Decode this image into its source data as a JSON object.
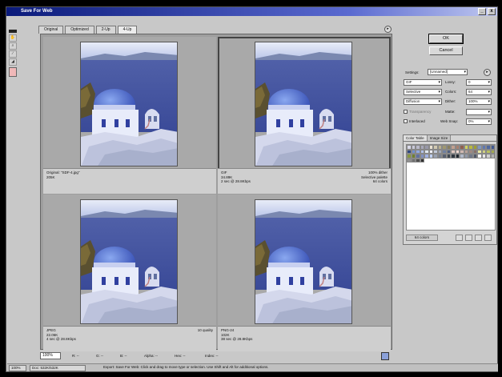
{
  "window": {
    "title": "Save For Web",
    "minimize_label": "_",
    "close_label": "x"
  },
  "tools": [
    "hand",
    "zoom",
    "eyedropper",
    "slice",
    "select"
  ],
  "tabs": [
    {
      "label": "Original",
      "active": false
    },
    {
      "label": "Optimized",
      "active": false
    },
    {
      "label": "2-Up",
      "active": false
    },
    {
      "label": "4-Up",
      "active": true
    }
  ],
  "panes": [
    {
      "left_lines": [
        "Original: \"SDF-4.jpg\"",
        "205K"
      ],
      "right_lines": [],
      "selected": false
    },
    {
      "left_lines": [
        "GIF",
        "34.89K",
        "2 sec @ 28.8Kbps"
      ],
      "right_lines": [
        "100% dither",
        "Selective palette",
        "64 colors"
      ],
      "selected": true
    },
    {
      "left_lines": [
        "JPEG",
        "22.06K",
        "4 sec @ 28.8Kbps"
      ],
      "right_lines": [
        "10 quality"
      ],
      "selected": false
    },
    {
      "left_lines": [
        "PNG-24",
        "102K",
        "38 sec @ 28.8Kbps"
      ],
      "right_lines": [],
      "selected": false
    }
  ],
  "side": {
    "ok_label": "OK",
    "cancel_label": "Cancel",
    "settings_label": "Settings:",
    "settings_value": "[Unnamed]",
    "format_value": "GIF",
    "reduction_value": "Selective",
    "dither_algo_value": "Diffusion",
    "lossy_label": "Lossy:",
    "lossy_value": "0",
    "colors_label": "Colors:",
    "colors_value": "64",
    "dither_label": "Dither:",
    "dither_value": "100%",
    "matte_label": "Matte:",
    "matte_value": "",
    "websnap_label": "Web Snap:",
    "websnap_value": "0%",
    "transparency_label": "Transparency",
    "interlaced_label": "Interlaced"
  },
  "swatches": {
    "tabs": [
      "Color Table",
      "Image Size"
    ],
    "active_tab": "Color Table",
    "count_label": "64 colors",
    "colors": [
      "#d8d8e8",
      "#c8c8d8",
      "#b8b8c8",
      "#a8a8b8",
      "#9898a8",
      "#e8e0d0",
      "#d0c8b0",
      "#b8b090",
      "#a09870",
      "#888060",
      "#c0a090",
      "#a88070",
      "#906050",
      "#d0d060",
      "#b8b840",
      "#a0a030",
      "#8098c0",
      "#6078b0",
      "#5068a0",
      "#405890",
      "#304880",
      "#7090d0",
      "#90a8e0",
      "#b0c0e8",
      "#e0e8f0",
      "#f0f0f8",
      "#c0c8d8",
      "#a0a8b8",
      "#7080a0",
      "#506080",
      "#e0c8c0",
      "#f0d8d0",
      "#d0b8b0",
      "#b8a098",
      "#a08880",
      "#887068",
      "#e8e8a0",
      "#d0d080",
      "#b8c060",
      "#a0a850",
      "#889840",
      "#708030",
      "#6070a0",
      "#8090c0",
      "#a0b0e0",
      "#c0d0f0",
      "#98a0b0",
      "#788090",
      "#586070",
      "#404850",
      "#303840",
      "#202830",
      "#b0b8c8",
      "#9098a8",
      "#707888",
      "#505868",
      "#f8f8f8",
      "#e8e8e8",
      "#d0d0d0",
      "#b0b0b0",
      "#909090",
      "#707070",
      "#505050",
      "#303030"
    ]
  },
  "bottom": {
    "zoom_value": "100%",
    "r_label": "R: --",
    "g_label": "G: --",
    "b_label": "B: --",
    "alpha_label": "Alpha: --",
    "hex_label": "Hex: --",
    "index_label": "Index: --"
  },
  "statusbar": {
    "zoom_value": "100%",
    "doc_text": "Doc: 532K/532K",
    "hint_text": "Export: Save For Web: Click and drag to move type or selection. Use Shift and Alt for additional options."
  }
}
